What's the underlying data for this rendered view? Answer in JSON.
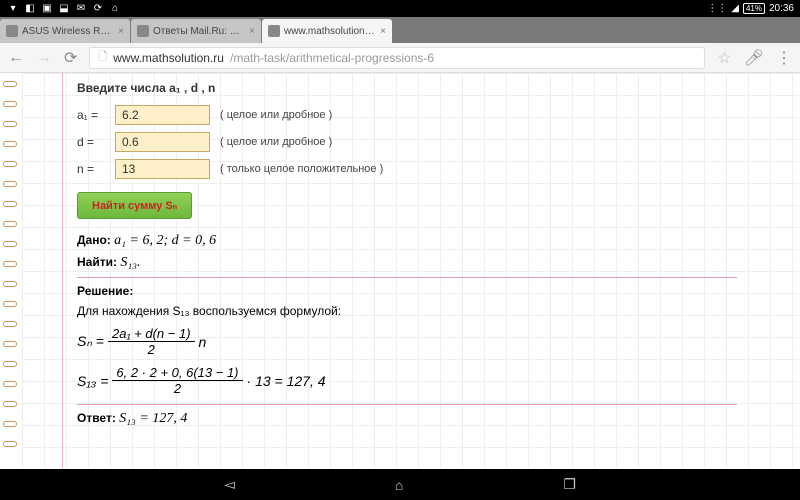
{
  "status": {
    "battery": "41%",
    "time": "20:36"
  },
  "tabs": [
    {
      "title": "ASUS Wireless Route"
    },
    {
      "title": "Ответы Mail.Ru: Дан"
    },
    {
      "title": "www.mathsolution.ru"
    }
  ],
  "url": {
    "domain": "www.mathsolution.ru",
    "path": "/math-task/arithmetical-progressions-6"
  },
  "form": {
    "heading": "Введите числа a₁ ,  d ,  n",
    "a1": {
      "label": "a₁  =",
      "value": "6.2",
      "hint": "( целое или дробное )"
    },
    "d": {
      "label": "d  =",
      "value": "0.6",
      "hint": "( целое или дробное )"
    },
    "n": {
      "label": "n  =",
      "value": "13",
      "hint": "( только целое положительное )"
    },
    "button": "Найти сумму Sₙ"
  },
  "solution": {
    "given_lbl": "Дано:",
    "given": "a₁ = 6, 2;   d = 0, 6",
    "find_lbl": "Найти:",
    "find": "S₁₃.",
    "sol_lbl": "Решение:",
    "explain": "Для нахождения S₁₃ воспользуемся формулой:",
    "f1": {
      "lhs": "Sₙ =",
      "num": "2a₁ + d(n − 1)",
      "den": "2",
      "tail": "n"
    },
    "f2": {
      "lhs": "S₁₃ =",
      "num": "6, 2 · 2 + 0, 6(13 − 1)",
      "den": "2",
      "tail": "· 13 = 127, 4"
    },
    "ans_lbl": "Ответ:",
    "ans": "S₁₃ = 127, 4"
  }
}
